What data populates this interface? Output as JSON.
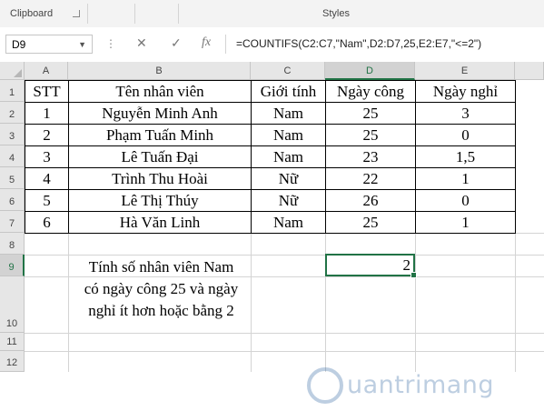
{
  "ribbon": {
    "clipboard_label": "Clipboard",
    "styles_label": "Styles"
  },
  "formula_bar": {
    "name_box": "D9",
    "cancel_glyph": "✕",
    "enter_glyph": "✓",
    "fx_glyph": "fx",
    "formula": "=COUNTIFS(C2:C7,\"Nam\",D2:D7,25,E2:E7,\"<=2\")"
  },
  "columns": [
    "A",
    "B",
    "C",
    "D",
    "E"
  ],
  "rows": [
    "1",
    "2",
    "3",
    "4",
    "5",
    "6",
    "7",
    "8",
    "9",
    "10",
    "11",
    "12"
  ],
  "table": {
    "headers": [
      "STT",
      "Tên nhân viên",
      "Giới tính",
      "Ngày công",
      "Ngày nghỉ"
    ],
    "records": [
      [
        "1",
        "Nguyễn Minh Anh",
        "Nam",
        "25",
        "3"
      ],
      [
        "2",
        "Phạm Tuấn Minh",
        "Nam",
        "25",
        "0"
      ],
      [
        "3",
        "Lê Tuấn Đại",
        "Nam",
        "23",
        "1,5"
      ],
      [
        "4",
        "Trình Thu Hoài",
        "Nữ",
        "22",
        "1"
      ],
      [
        "5",
        "Lê Thị Thúy",
        "Nữ",
        "26",
        "0"
      ],
      [
        "6",
        "Hà Văn Linh",
        "Nam",
        "25",
        "1"
      ]
    ]
  },
  "note": {
    "line1": "Tính số nhân viên Nam",
    "line2": "có ngày công 25 và ngày",
    "line3": "nghỉ ít hơn hoặc bằng 2"
  },
  "result": {
    "cell": "D9",
    "value": "2"
  },
  "watermark": {
    "text": "uantrimang"
  },
  "colors": {
    "accent": "#217346",
    "header_bg": "#e6e6e6",
    "gridline": "#d4d4d4"
  }
}
